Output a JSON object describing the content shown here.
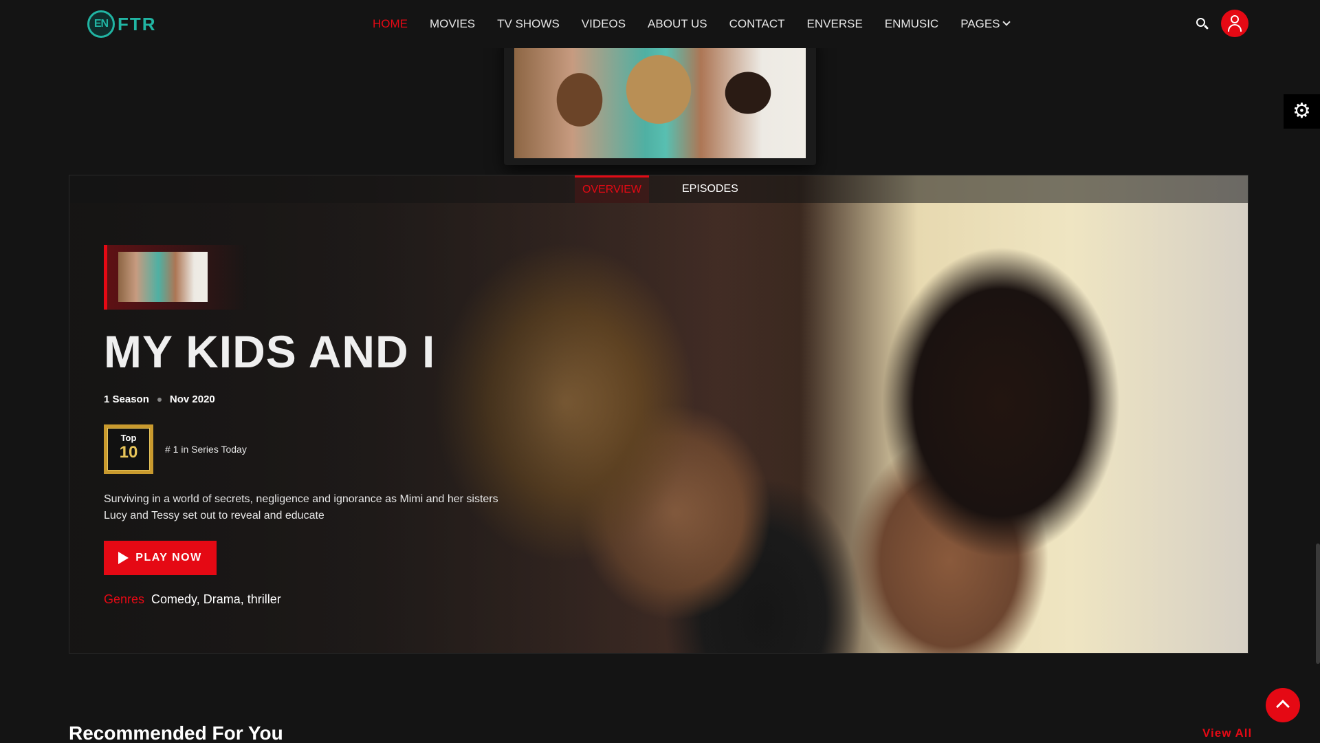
{
  "brand": {
    "badge": "EN",
    "name": "FTR",
    "accent": "#21b5a3"
  },
  "nav": {
    "items": [
      "Home",
      "Movies",
      "TV Shows",
      "Videos",
      "About Us",
      "Contact",
      "Enverse",
      "Enmusic",
      "Pages"
    ],
    "active": "Home"
  },
  "header_icons": [
    "search-icon",
    "user-icon"
  ],
  "settings_icon": "gear-icon",
  "hero": {
    "tabs": [
      "Overview",
      "Episodes"
    ],
    "active_tab": "Overview",
    "title": "MY KIDS AND I",
    "seasons": "1 Season",
    "release": "Nov 2020",
    "top_label": "Top",
    "top_number": "10",
    "rank_text": "# 1 in Series Today",
    "description": "Surviving in a world of secrets, negligence and ignorance as Mimi and her sisters Lucy and Tessy set out to reveal and educate",
    "play_label": "Play Now",
    "genres_label": "Genres",
    "genres_value": "Comedy, Drama, thriller"
  },
  "recommended": {
    "title": "Recommended For You",
    "view_all": "View All"
  },
  "colors": {
    "brand_red": "#e50914",
    "background": "#141414",
    "gold": "#c99a2e"
  }
}
